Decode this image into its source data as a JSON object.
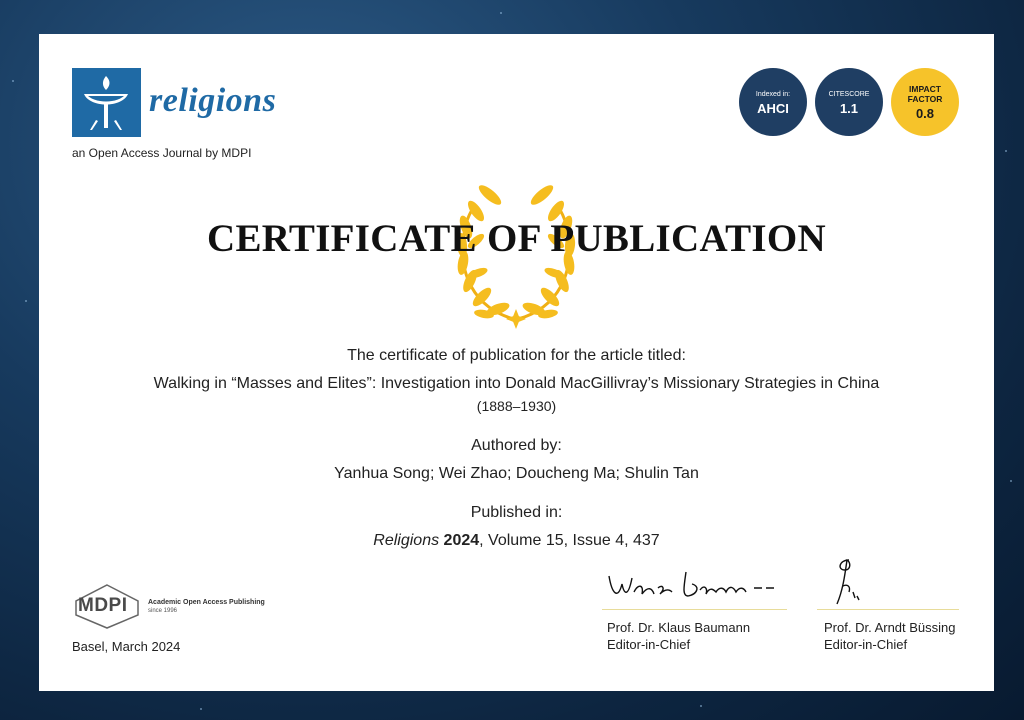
{
  "journal": {
    "name": "religions",
    "subtitle": "an Open Access Journal by MDPI"
  },
  "badges": [
    {
      "label": "Indexed in:",
      "value": "AHCI"
    },
    {
      "label": "CITESCORE",
      "value": "1.1"
    },
    {
      "label": "IMPACT FACTOR",
      "value": "0.8"
    }
  ],
  "certificate": {
    "title": "CERTIFICATE OF PUBLICATION",
    "intro": "The certificate of publication for the article titled:",
    "article_title_line1": "Walking in “Masses and Elites”: Investigation into Donald MacGillivray’s Missionary Strategies in China",
    "article_title_line2": "(1888–1930)",
    "authored_label": "Authored by:",
    "authors": "Yanhua Song; Wei Zhao; Doucheng Ma; Shulin Tan",
    "published_label": "Published in:",
    "journal_italic": "Religions",
    "year": "2024",
    "volume_issue": ", Volume 15, Issue 4, 437"
  },
  "publisher": {
    "logo_text": "MDPI",
    "tagline": "Academic Open Access Publishing",
    "since": "since 1996",
    "place_date": "Basel, March 2024"
  },
  "signatories": [
    {
      "name": "Prof. Dr. Klaus Baumann",
      "role": "Editor-in-Chief"
    },
    {
      "name": "Prof. Dr. Arndt Büssing",
      "role": "Editor-in-Chief"
    }
  ],
  "colors": {
    "brand_blue": "#1f6aa5",
    "badge_navy": "#1f3e63",
    "badge_gold": "#f6c32a",
    "laurel_gold": "#f5bd1f"
  }
}
